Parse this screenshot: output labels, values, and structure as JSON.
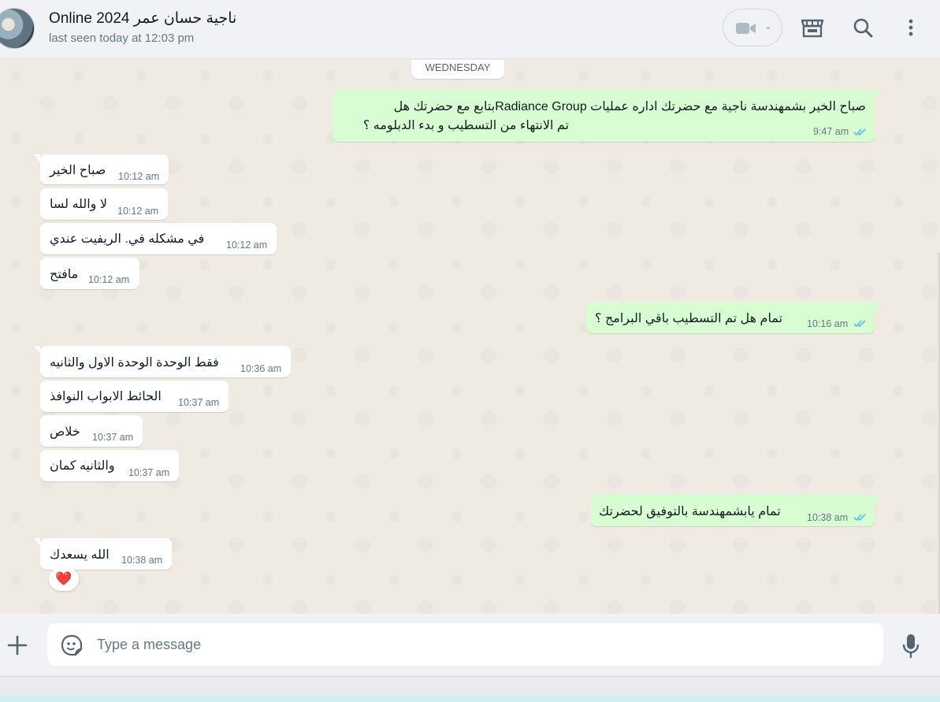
{
  "header": {
    "contact_name": "Online 2024 ناجية حسان عمر",
    "contact_status": "last seen today at 12:03 pm",
    "icons": [
      "video-call-icon",
      "chevron-down-icon",
      "catalog-shop-icon",
      "search-icon",
      "menu-dots-icon"
    ]
  },
  "chat": {
    "date_divider": "WEDNESDAY",
    "messages": [
      {
        "dir": "out",
        "lines": [
          "صباح الخير بشمهندسة ناجية  مع  حضرتك اداره عمليات Radiance Groupبتابع مع حضرتك هل",
          "تم الانتهاء من التسطيب و بدء الدبلومه ؟"
        ],
        "time": "9:47 am",
        "status": "read"
      },
      {
        "dir": "in",
        "text": "صباح الخير",
        "time": "10:12 am"
      },
      {
        "dir": "in",
        "text": "لا والله لسا",
        "time": "10:12 am"
      },
      {
        "dir": "in",
        "text": "في مشكله في. الريفيت عندي",
        "time": "10:12 am"
      },
      {
        "dir": "in",
        "text": "مافتح",
        "time": "10:12 am"
      },
      {
        "dir": "out",
        "text": "تمام هل تم التسطيب باقي البرامج ؟",
        "time": "10:16 am",
        "status": "read"
      },
      {
        "dir": "in",
        "text": "فقط الوحدة الوحدة الاول والثانيه",
        "time": "10:36 am"
      },
      {
        "dir": "in",
        "text": "الحائط الابواب النوافذ",
        "time": "10:37 am"
      },
      {
        "dir": "in",
        "text": "خلاص",
        "time": "10:37 am"
      },
      {
        "dir": "in",
        "text": "والثانيه كمان",
        "time": "10:37 am"
      },
      {
        "dir": "out",
        "text": "تمام يابشمهندسة بالتوفيق لحضرتك",
        "time": "10:38 am",
        "status": "read"
      },
      {
        "dir": "in",
        "text": "الله يسعدك",
        "time": "10:38 am",
        "reaction": "❤️"
      }
    ]
  },
  "composer": {
    "placeholder": "Type a message",
    "icons": [
      "plus-icon",
      "sticker-icon",
      "microphone-icon"
    ]
  },
  "colors": {
    "header_bg": "#f0f2f5",
    "chat_bg": "#efeae2",
    "incoming_bubble": "#ffffff",
    "outgoing_bubble": "#d9fdd3",
    "read_ticks": "#53bdeb",
    "secondary_text": "#667781"
  }
}
